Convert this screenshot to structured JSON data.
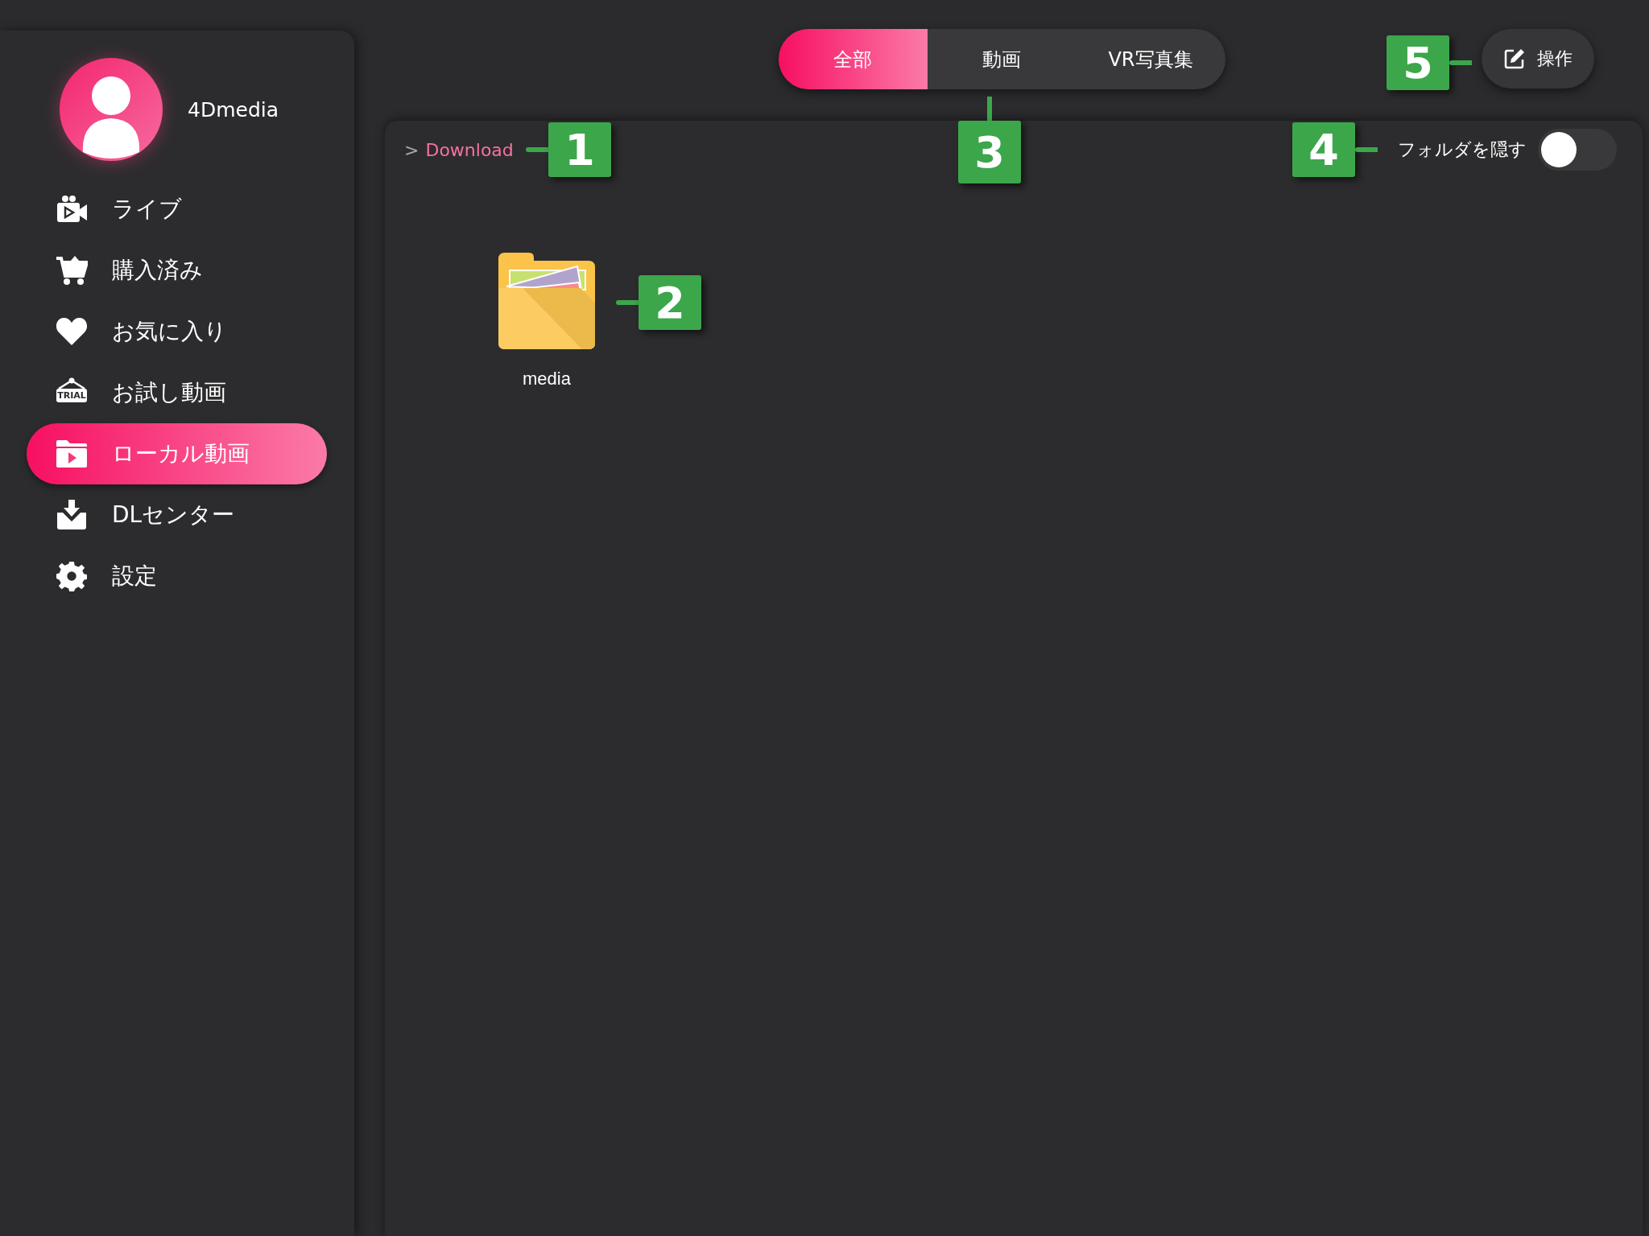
{
  "user": {
    "name": "4Dmedia"
  },
  "sidebar": {
    "items": [
      {
        "label": "ライブ",
        "kind": "camera",
        "selected": false
      },
      {
        "label": "購入済み",
        "kind": "cart",
        "selected": false
      },
      {
        "label": "お気に入り",
        "kind": "heart",
        "selected": false
      },
      {
        "label": "お試し動画",
        "kind": "trial",
        "selected": false,
        "icon_text": "TRIAL"
      },
      {
        "label": "ローカル動画",
        "kind": "folder",
        "selected": true
      },
      {
        "label": "DLセンター",
        "kind": "download",
        "selected": false
      },
      {
        "label": "設定",
        "kind": "gear",
        "selected": false
      }
    ]
  },
  "tabs": [
    {
      "label": "全部",
      "selected": true
    },
    {
      "label": "動画",
      "selected": false
    },
    {
      "label": "VR写真集",
      "selected": false
    }
  ],
  "operation_button": {
    "label": "操作"
  },
  "breadcrumb": {
    "separator": ">",
    "path": "Download"
  },
  "hide_folders": {
    "label": "フォルダを隠す",
    "on": false
  },
  "files": [
    {
      "name": "media",
      "kind": "folder"
    }
  ],
  "callouts": [
    {
      "number": "1"
    },
    {
      "number": "2"
    },
    {
      "number": "3"
    },
    {
      "number": "4"
    },
    {
      "number": "5"
    }
  ]
}
